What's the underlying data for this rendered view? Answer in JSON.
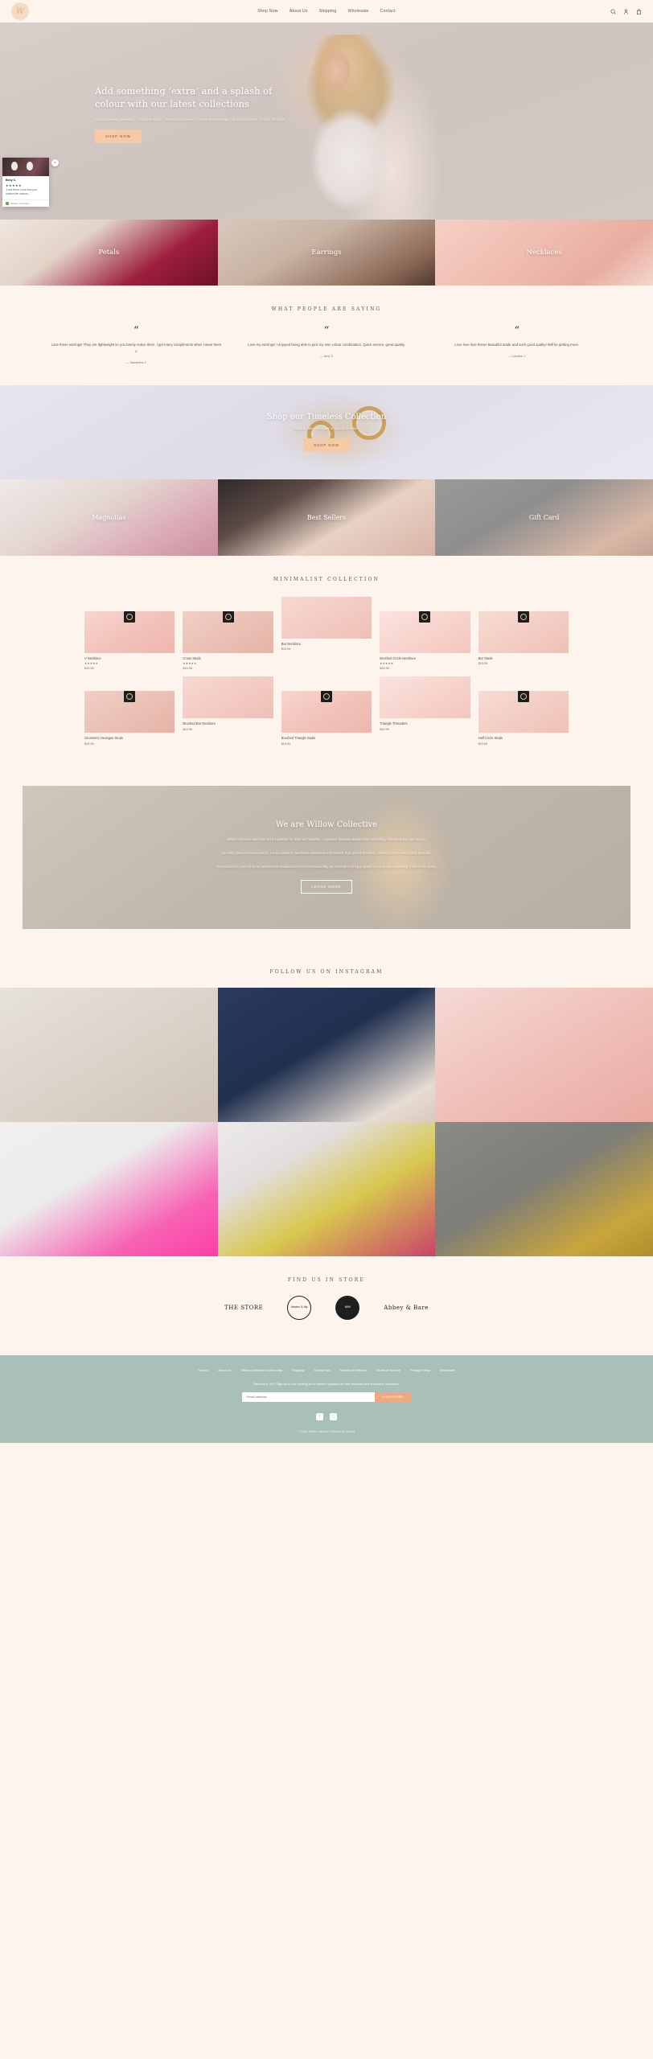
{
  "header": {
    "logo_text": "W",
    "nav": [
      {
        "label": "Shop Now",
        "caret": "▾"
      },
      {
        "label": "About Us"
      },
      {
        "label": "Shipping"
      },
      {
        "label": "Wholesale"
      },
      {
        "label": "Contact"
      }
    ],
    "icons": [
      "search-icon",
      "account-icon",
      "cart-icon"
    ]
  },
  "hero": {
    "headline": "Add something ‘extra’ and a splash of colour with our latest collections",
    "subtitle": "Contemporary jewellery | Floral designs | Minimalist pieces | Statement earrings | Gold and silver | Cubic zirconia",
    "cta": "SHOP NOW"
  },
  "review_popup": {
    "name": "Bexy C.",
    "stars": "★★★★★",
    "text": "\"Love them. Love how you custom the colours...\"",
    "verified": "Verified Purchase",
    "close": "×"
  },
  "categories": [
    {
      "label": "Petals"
    },
    {
      "label": "Earrings"
    },
    {
      "label": "Necklaces"
    }
  ],
  "testimonials": {
    "title": "WHAT PEOPLE ARE SAYING",
    "quote_mark": "“",
    "items": [
      {
        "text": "Love these earrings! They are lightweight so you barely notice them. I get many compliments when I wear them x",
        "author": "— Samantha Y"
      },
      {
        "text": "Love my earrings! I enjoyed being able to pick my own colour combination. Quick service, great quality.",
        "author": "— Amy S"
      },
      {
        "text": "Love love love these! Beautiful made and such good quality! Will be getting more.",
        "author": "— Candice C"
      }
    ]
  },
  "timeless": {
    "title": "Shop our Timeless Collection",
    "subtitle": "Made to last – everyday or special occasion",
    "cta": "SHOP NOW"
  },
  "categories2": [
    {
      "label": "Magnolias"
    },
    {
      "label": "Best Sellers"
    },
    {
      "label": "Gift Card"
    }
  ],
  "collection": {
    "title": "MINIMALIST COLLECTION",
    "products": [
      {
        "name": "V Necklace",
        "stars": "★★★★★",
        "reviews": "(1)",
        "price": "$19.99",
        "img": "g1"
      },
      {
        "name": "Cross Studs",
        "stars": "★★★★★",
        "reviews": "(2)",
        "price": "$24.99",
        "img": "g2"
      },
      {
        "name": "Bar Necklace",
        "stars": "",
        "reviews": "",
        "price": "$19.99",
        "img": "g3"
      },
      {
        "name": "Brushed Circle Necklace",
        "stars": "★★★★★",
        "reviews": "(1)",
        "price": "$19.99",
        "img": "g4"
      },
      {
        "name": "Bar Studs",
        "stars": "",
        "reviews": "",
        "price": "$19.99",
        "img": "g5"
      },
      {
        "name": "Geometric Hexagon Studs",
        "stars": "",
        "reviews": "",
        "price": "$19.99",
        "img": "g2"
      },
      {
        "name": "Brushed Bar Necklace",
        "stars": "",
        "reviews": "",
        "price": "$19.99",
        "img": "g3"
      },
      {
        "name": "Brushed Triangle Studs",
        "stars": "",
        "reviews": "",
        "price": "$19.99",
        "img": "g1"
      },
      {
        "name": "Triangle Threaders",
        "stars": "",
        "reviews": "",
        "price": "$19.99",
        "img": "g4"
      },
      {
        "name": "Half Circle Studs",
        "stars": "",
        "reviews": "",
        "price": "$24.99",
        "img": "g5"
      }
    ]
  },
  "about": {
    "title": "We are Willow Collective",
    "p1": "Willow Collective was born from a passion for Style and Sparkle – a passion that was directed into something creative and unique to you.",
    "p2": "Avoiding mass produced pieces, we specialise in handmade statement and minimal style pieces therefore, allowing for the best quality possible.",
    "p3": "Now stocked in over 40 stores across New Zealand and more internationally, we continue to bring a splash of colour and something ‘extra’ to the world.",
    "cta": "LEARN MORE"
  },
  "instagram": {
    "title": "FOLLOW US ON INSTAGRAM",
    "tiles": [
      "ig1",
      "ig2",
      "ig3",
      "ig4",
      "ig5",
      "ig6"
    ]
  },
  "stores": {
    "title": "FIND US IN STORE",
    "items": [
      {
        "name": "THE STORE",
        "type": "wordmark"
      },
      {
        "name": "kinder & lily",
        "type": "circle"
      },
      {
        "name": "MW",
        "type": "dark"
      },
      {
        "name": "Abbey & Bare",
        "type": "script"
      }
    ]
  },
  "footer": {
    "links": [
      "Search",
      "About Us",
      "Willow Collective Community",
      "Shipping",
      "Contact Us",
      "Returns & Refunds",
      "Terms of Service",
      "Privacy Policy",
      "Wholesale"
    ],
    "newsletter_note": "Become a VIP! Sign up to our mailing list to receive updates on new releases and exclusive discounts.",
    "email_placeholder": "Email address",
    "subscribe": "SUBSCRIBE",
    "social": [
      "facebook-icon",
      "instagram-icon"
    ],
    "copyright": "© 2021, Willow Collective. Powered by Shopify"
  },
  "colors": {
    "cream": "#fdf4ed",
    "peach": "#f7c9a4",
    "sage": "#a9bfb9"
  }
}
